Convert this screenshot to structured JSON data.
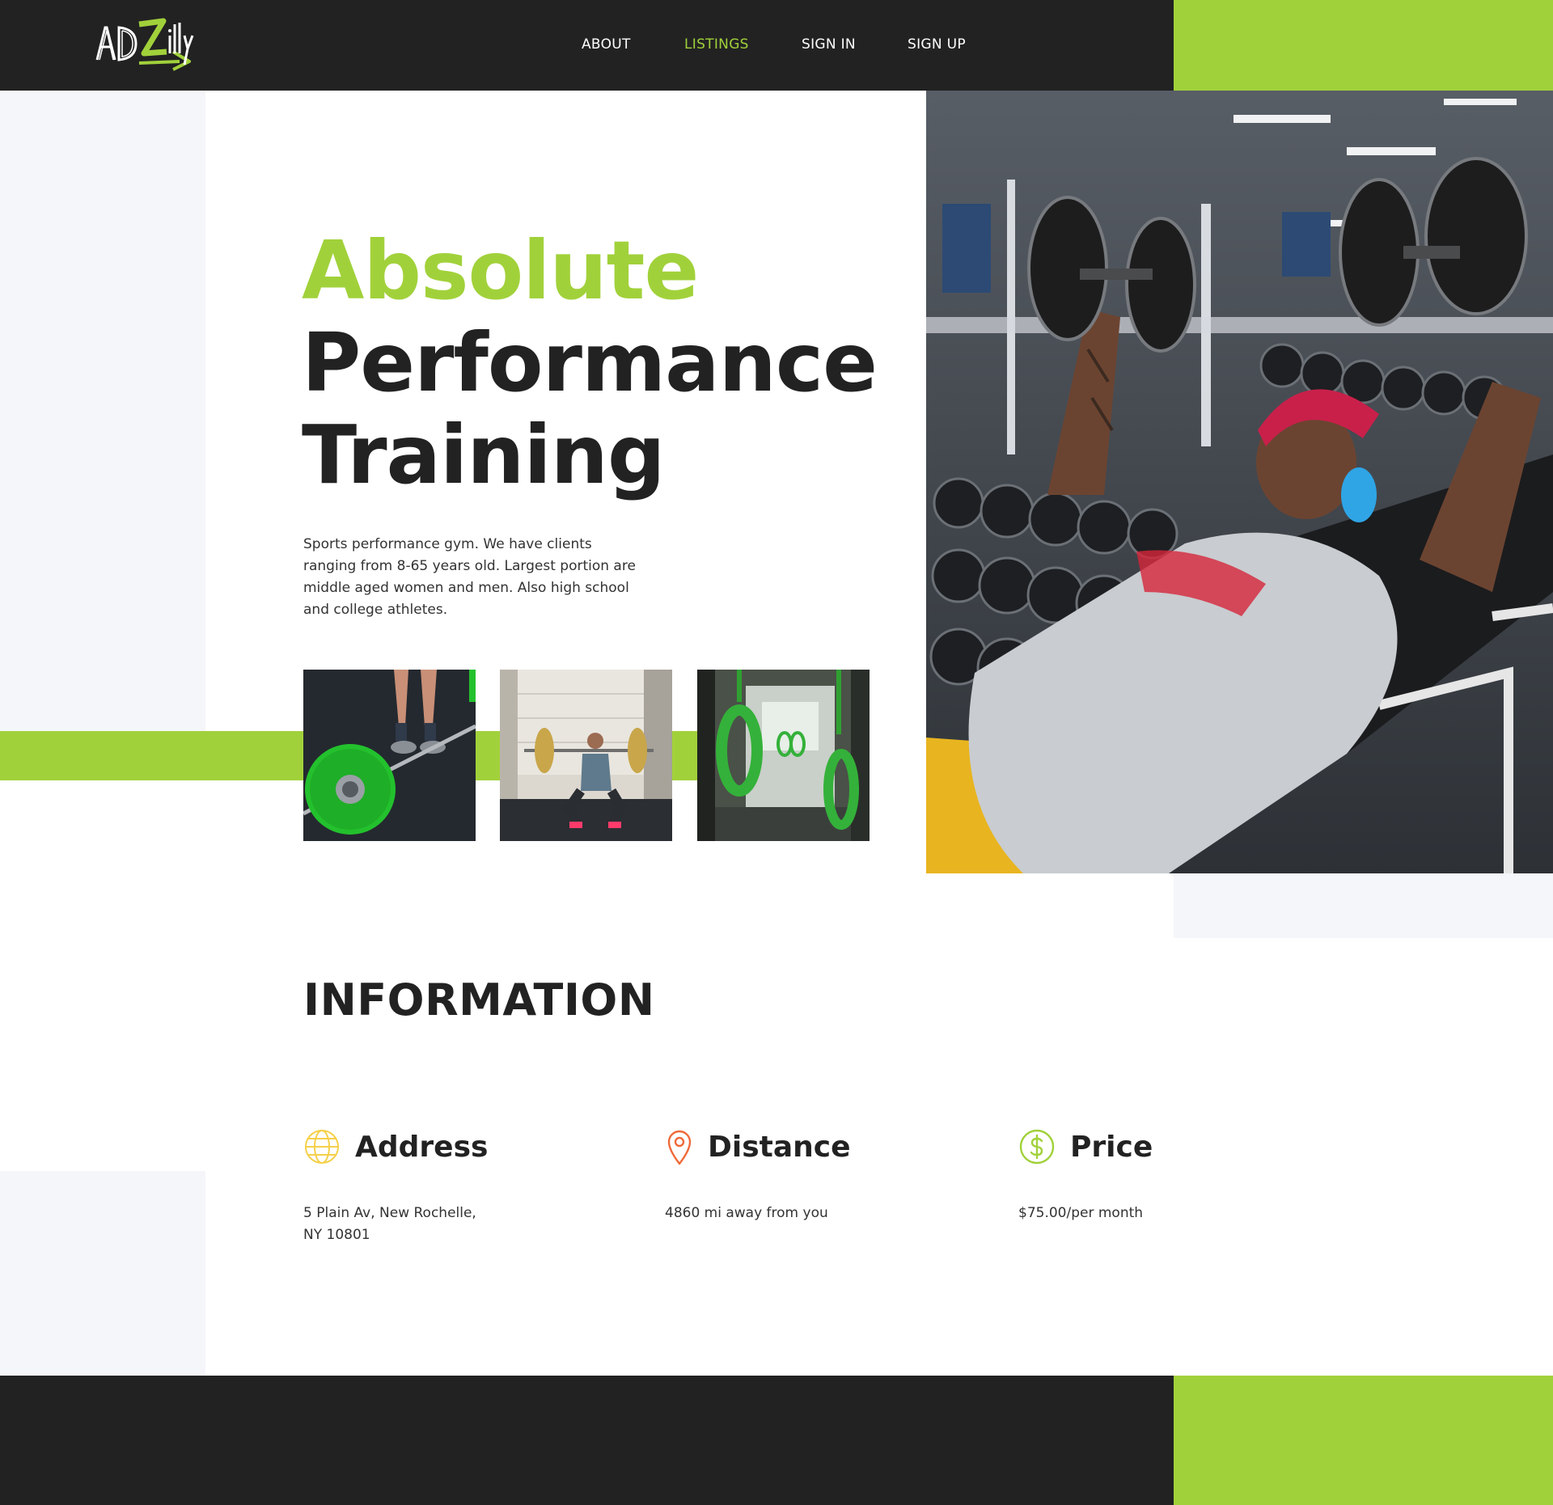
{
  "brand": {
    "logo_text": "ADZilly",
    "colors": {
      "accent": "#a1d13a",
      "dark": "#222222",
      "light_bg": "#f5f6fa"
    }
  },
  "nav": {
    "items": [
      {
        "label": "ABOUT",
        "active": false
      },
      {
        "label": "LISTINGS",
        "active": true
      },
      {
        "label": "SIGN IN",
        "active": false
      },
      {
        "label": "SIGN UP",
        "active": false
      }
    ]
  },
  "hero": {
    "title_line1": "Absolute",
    "title_line2": "Performance",
    "title_line3": "Training",
    "description": "Sports performance gym. We have clients ranging from 8-65 years old. Largest portion are middle aged women and men. Also high school and college athletes."
  },
  "information": {
    "title": "INFORMATION",
    "address": {
      "label": "Address",
      "icon": "globe-icon",
      "icon_color": "#f5d04a",
      "line1": "5 Plain Av, New Rochelle,",
      "line2": "NY 10801"
    },
    "distance": {
      "label": "Distance",
      "icon": "map-pin-icon",
      "icon_color": "#ef6a3a",
      "value": "4860 mi away from you"
    },
    "price": {
      "label": "Price",
      "icon": "dollar-circle-icon",
      "icon_color": "#a1d13a",
      "value": "$75.00/per month"
    }
  }
}
